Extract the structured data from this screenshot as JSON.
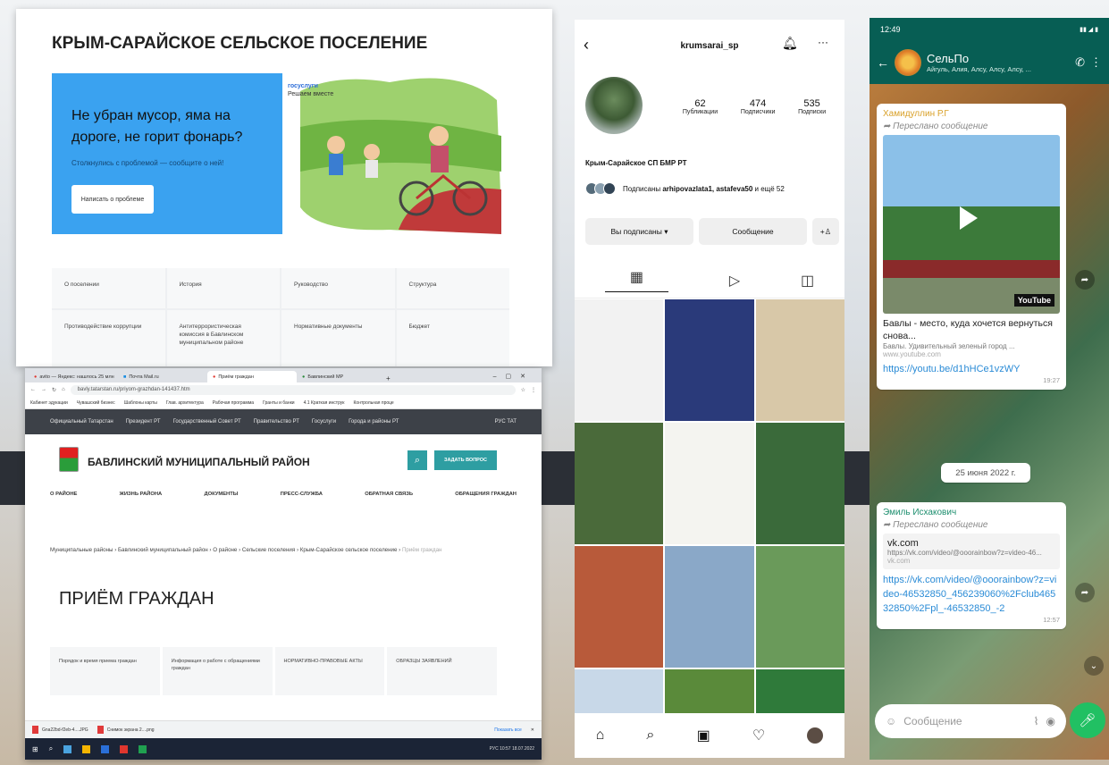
{
  "settlement": {
    "title": "КРЫМ-САРАЙСКОЕ СЕЛЬСКОЕ ПОСЕЛЕНИЕ",
    "banner_heading": "Не убран мусор, яма на дороге, не горит фонарь?",
    "banner_sub": "Столкнулись с проблемой — сообщите о ней!",
    "banner_button": "Написать о проблеме",
    "gos_logo": "госуслуги",
    "gos_tagline": "Решаем вместе",
    "menu": [
      "О поселении",
      "История",
      "Руководство",
      "Структура",
      "Противодействие коррупции",
      "Антитеррористическая комиссия в Бавлинском муниципальном районе",
      "Нормативные документы",
      "Бюджет"
    ]
  },
  "district": {
    "tabs": [
      "avito — Яндекс: нашлось 25 млн",
      "Почта Mail.ru",
      "Приём граждан",
      "Бавлинский МР"
    ],
    "url": "bavly.tatarstan.ru/priyom-grazhdan-141437.htm",
    "bookmarks": [
      "Кабинет эдукации",
      "Чувашский бизнес",
      "Шаблоны карты",
      "Глав. архитектура",
      "Рабочая программа",
      "Гранты и банки",
      "4.1 Краткая инструк",
      "Контрольная проце"
    ],
    "top_links": [
      "Официальный Татарстан",
      "Президент РТ",
      "Государственный Совет РТ",
      "Правительство РТ",
      "Госуслуги",
      "Города и районы РТ"
    ],
    "langs": "РУС  ТАТ",
    "name": "БАВЛИНСКИЙ МУНИЦИПАЛЬНЫЙ РАЙОН",
    "ask_button": "ЗАДАТЬ ВОПРОС",
    "menu": [
      "О РАЙОНЕ",
      "ЖИЗНЬ РАЙОНА",
      "ДОКУМЕНТЫ",
      "ПРЕСС-СЛУЖБА",
      "ОБРАТНАЯ СВЯЗЬ",
      "ОБРАЩЕНИЯ ГРАЖДАН"
    ],
    "breadcrumb": "Муниципальные районы › Бавлинский муниципальный район › О районе › Сельские поселения › Крым-Сарайское сельское поселение › ",
    "breadcrumb_last": "Приём граждан",
    "page_title": "ПРИЁМ ГРАЖДАН",
    "cards": [
      "Порядок и время приема граждан",
      "Информация о работе с обращениями граждан",
      "НОРМАТИВНО-ПРАВОВЫЕ АКТЫ",
      "ОБРАЗЦЫ ЗАЯВЛЕНИЙ"
    ],
    "downloads": [
      "Gna22bd-f2eb-4....JPG",
      "Снимок экрана 2....png"
    ],
    "show_all": "Показать все",
    "tray": "РУС  10:57  18.07.2022"
  },
  "instagram": {
    "username": "krumsarai_sp",
    "posts": "62",
    "posts_label": "Публикации",
    "followers": "474",
    "followers_label": "Подписчики",
    "following": "535",
    "following_label": "Подписки",
    "profile_name": "Крым-Сарайское СП БМР РТ",
    "followed_by": "Подписаны ",
    "followed_by_names": "arhipovazlata1, astafeva50",
    "followed_by_more": " и ещё 52",
    "btn_following": "Вы подписаны ▾",
    "btn_message": "Сообщение",
    "post_colors": [
      "#f2f2f2",
      "#2a3a7a",
      "#d8c8a8",
      "#4a6a3a",
      "#f4f4f0",
      "#3a6a3a",
      "#b85a3a",
      "#8aa8c8",
      "#6a9a5a",
      "#c8d8e8",
      "#5a8a3a",
      "#2f7a3a"
    ]
  },
  "whatsapp": {
    "time": "12:49",
    "group_name": "СельПо",
    "members": "Айгуль, Алия, Алсу, Алсу, Алсу, ...",
    "msg1": {
      "sender": "Хамидуллин Р.Г",
      "forwarded": "Переслано сообщение",
      "yt_label": "YouTube",
      "title": "Бавлы - место, куда хочется вернуться снова...",
      "desc": "Бавлы. Удивительный зеленый город ...",
      "site": "www.youtube.com",
      "link": "https://youtu.be/d1hHCe1vzWY",
      "time": "19:27"
    },
    "date_chip": "25 июня 2022 г.",
    "msg2": {
      "sender": "Эмиль Исхакович",
      "forwarded": "Переслано сообщение",
      "preview_title": "vk.com",
      "preview_url": "https://vk.com/video/@oоorainbow?z=video-46...",
      "preview_site": "vk.com",
      "link": "https://vk.com/video/@ooorainbow?z=video-46532850_456239060%2Fclub46532850%2Fpl_-46532850_-2",
      "time": "12:57"
    },
    "input_placeholder": "Сообщение",
    "colors": {
      "header": "#075e54",
      "mic": "#21c063",
      "sender1": "#d9a12a",
      "sender2": "#1e8f6f"
    }
  }
}
